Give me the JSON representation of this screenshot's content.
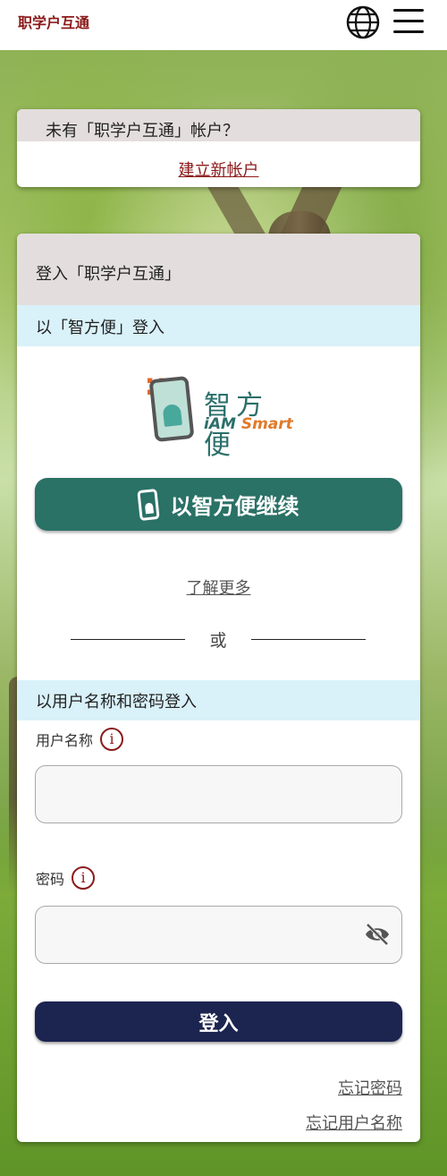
{
  "header": {
    "brand": "职学户互通",
    "globe_icon": "globe-icon",
    "menu_icon": "hamburger-menu-icon"
  },
  "signup_card": {
    "question": "未有「职学户互通」帐户？",
    "link": "建立新帐户"
  },
  "login_card": {
    "title": "登入「职学户互通」",
    "iam_section": "以「智方便」登入",
    "iam_logo_zh": "智方便",
    "iam_logo_en_a": "iAM ",
    "iam_logo_en_b": "Smart",
    "iam_button": "以智方便继续",
    "learn_more": "了解更多",
    "or_text": "或",
    "password_section": "以用户名称和密码登入",
    "username_label": "用户名称",
    "username_value": "",
    "password_label": "密码",
    "password_value": "",
    "info_glyph": "i",
    "login_button": "登入",
    "forgot_password": "忘记密码",
    "forgot_username": "忘记用户名称"
  },
  "colors": {
    "brand": "#8b1a1a",
    "iam_button": "#2a7166",
    "login_button": "#1c2450",
    "section_blue": "#d9f1f9",
    "section_gray": "#e3dedd"
  }
}
